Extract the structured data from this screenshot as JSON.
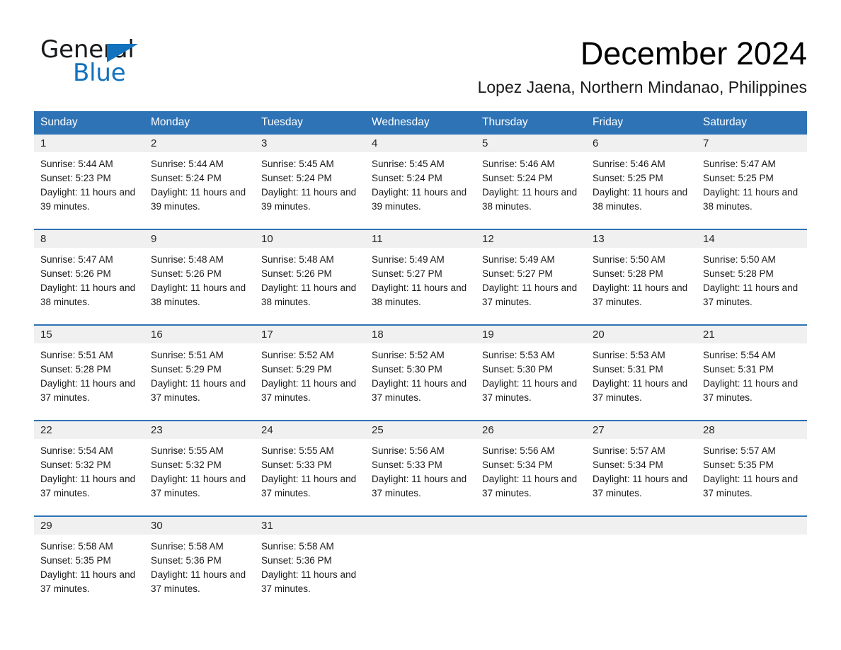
{
  "brand": {
    "name_part1": "General",
    "name_part2": "Blue",
    "logo_icon": "triangle-flag-icon",
    "accent_color": "#1272bd"
  },
  "header": {
    "month_title": "December 2024",
    "location": "Lopez Jaena, Northern Mindanao, Philippines"
  },
  "theme": {
    "header_blue": "#2e73b5",
    "daynum_band_gray": "#f0f0f0",
    "text": "#1a1a1a"
  },
  "weekday_headers": [
    "Sunday",
    "Monday",
    "Tuesday",
    "Wednesday",
    "Thursday",
    "Friday",
    "Saturday"
  ],
  "labels": {
    "sunrise_prefix": "Sunrise:",
    "sunset_prefix": "Sunset:",
    "daylight_prefix": "Daylight:"
  },
  "weeks": [
    [
      {
        "day": "1",
        "sunrise": "Sunrise: 5:44 AM",
        "sunset": "Sunset: 5:23 PM",
        "daylight": "Daylight: 11 hours and 39 minutes."
      },
      {
        "day": "2",
        "sunrise": "Sunrise: 5:44 AM",
        "sunset": "Sunset: 5:24 PM",
        "daylight": "Daylight: 11 hours and 39 minutes."
      },
      {
        "day": "3",
        "sunrise": "Sunrise: 5:45 AM",
        "sunset": "Sunset: 5:24 PM",
        "daylight": "Daylight: 11 hours and 39 minutes."
      },
      {
        "day": "4",
        "sunrise": "Sunrise: 5:45 AM",
        "sunset": "Sunset: 5:24 PM",
        "daylight": "Daylight: 11 hours and 39 minutes."
      },
      {
        "day": "5",
        "sunrise": "Sunrise: 5:46 AM",
        "sunset": "Sunset: 5:24 PM",
        "daylight": "Daylight: 11 hours and 38 minutes."
      },
      {
        "day": "6",
        "sunrise": "Sunrise: 5:46 AM",
        "sunset": "Sunset: 5:25 PM",
        "daylight": "Daylight: 11 hours and 38 minutes."
      },
      {
        "day": "7",
        "sunrise": "Sunrise: 5:47 AM",
        "sunset": "Sunset: 5:25 PM",
        "daylight": "Daylight: 11 hours and 38 minutes."
      }
    ],
    [
      {
        "day": "8",
        "sunrise": "Sunrise: 5:47 AM",
        "sunset": "Sunset: 5:26 PM",
        "daylight": "Daylight: 11 hours and 38 minutes."
      },
      {
        "day": "9",
        "sunrise": "Sunrise: 5:48 AM",
        "sunset": "Sunset: 5:26 PM",
        "daylight": "Daylight: 11 hours and 38 minutes."
      },
      {
        "day": "10",
        "sunrise": "Sunrise: 5:48 AM",
        "sunset": "Sunset: 5:26 PM",
        "daylight": "Daylight: 11 hours and 38 minutes."
      },
      {
        "day": "11",
        "sunrise": "Sunrise: 5:49 AM",
        "sunset": "Sunset: 5:27 PM",
        "daylight": "Daylight: 11 hours and 38 minutes."
      },
      {
        "day": "12",
        "sunrise": "Sunrise: 5:49 AM",
        "sunset": "Sunset: 5:27 PM",
        "daylight": "Daylight: 11 hours and 37 minutes."
      },
      {
        "day": "13",
        "sunrise": "Sunrise: 5:50 AM",
        "sunset": "Sunset: 5:28 PM",
        "daylight": "Daylight: 11 hours and 37 minutes."
      },
      {
        "day": "14",
        "sunrise": "Sunrise: 5:50 AM",
        "sunset": "Sunset: 5:28 PM",
        "daylight": "Daylight: 11 hours and 37 minutes."
      }
    ],
    [
      {
        "day": "15",
        "sunrise": "Sunrise: 5:51 AM",
        "sunset": "Sunset: 5:28 PM",
        "daylight": "Daylight: 11 hours and 37 minutes."
      },
      {
        "day": "16",
        "sunrise": "Sunrise: 5:51 AM",
        "sunset": "Sunset: 5:29 PM",
        "daylight": "Daylight: 11 hours and 37 minutes."
      },
      {
        "day": "17",
        "sunrise": "Sunrise: 5:52 AM",
        "sunset": "Sunset: 5:29 PM",
        "daylight": "Daylight: 11 hours and 37 minutes."
      },
      {
        "day": "18",
        "sunrise": "Sunrise: 5:52 AM",
        "sunset": "Sunset: 5:30 PM",
        "daylight": "Daylight: 11 hours and 37 minutes."
      },
      {
        "day": "19",
        "sunrise": "Sunrise: 5:53 AM",
        "sunset": "Sunset: 5:30 PM",
        "daylight": "Daylight: 11 hours and 37 minutes."
      },
      {
        "day": "20",
        "sunrise": "Sunrise: 5:53 AM",
        "sunset": "Sunset: 5:31 PM",
        "daylight": "Daylight: 11 hours and 37 minutes."
      },
      {
        "day": "21",
        "sunrise": "Sunrise: 5:54 AM",
        "sunset": "Sunset: 5:31 PM",
        "daylight": "Daylight: 11 hours and 37 minutes."
      }
    ],
    [
      {
        "day": "22",
        "sunrise": "Sunrise: 5:54 AM",
        "sunset": "Sunset: 5:32 PM",
        "daylight": "Daylight: 11 hours and 37 minutes."
      },
      {
        "day": "23",
        "sunrise": "Sunrise: 5:55 AM",
        "sunset": "Sunset: 5:32 PM",
        "daylight": "Daylight: 11 hours and 37 minutes."
      },
      {
        "day": "24",
        "sunrise": "Sunrise: 5:55 AM",
        "sunset": "Sunset: 5:33 PM",
        "daylight": "Daylight: 11 hours and 37 minutes."
      },
      {
        "day": "25",
        "sunrise": "Sunrise: 5:56 AM",
        "sunset": "Sunset: 5:33 PM",
        "daylight": "Daylight: 11 hours and 37 minutes."
      },
      {
        "day": "26",
        "sunrise": "Sunrise: 5:56 AM",
        "sunset": "Sunset: 5:34 PM",
        "daylight": "Daylight: 11 hours and 37 minutes."
      },
      {
        "day": "27",
        "sunrise": "Sunrise: 5:57 AM",
        "sunset": "Sunset: 5:34 PM",
        "daylight": "Daylight: 11 hours and 37 minutes."
      },
      {
        "day": "28",
        "sunrise": "Sunrise: 5:57 AM",
        "sunset": "Sunset: 5:35 PM",
        "daylight": "Daylight: 11 hours and 37 minutes."
      }
    ],
    [
      {
        "day": "29",
        "sunrise": "Sunrise: 5:58 AM",
        "sunset": "Sunset: 5:35 PM",
        "daylight": "Daylight: 11 hours and 37 minutes."
      },
      {
        "day": "30",
        "sunrise": "Sunrise: 5:58 AM",
        "sunset": "Sunset: 5:36 PM",
        "daylight": "Daylight: 11 hours and 37 minutes."
      },
      {
        "day": "31",
        "sunrise": "Sunrise: 5:58 AM",
        "sunset": "Sunset: 5:36 PM",
        "daylight": "Daylight: 11 hours and 37 minutes."
      },
      {
        "day": "",
        "sunrise": "",
        "sunset": "",
        "daylight": ""
      },
      {
        "day": "",
        "sunrise": "",
        "sunset": "",
        "daylight": ""
      },
      {
        "day": "",
        "sunrise": "",
        "sunset": "",
        "daylight": ""
      },
      {
        "day": "",
        "sunrise": "",
        "sunset": "",
        "daylight": ""
      }
    ]
  ]
}
